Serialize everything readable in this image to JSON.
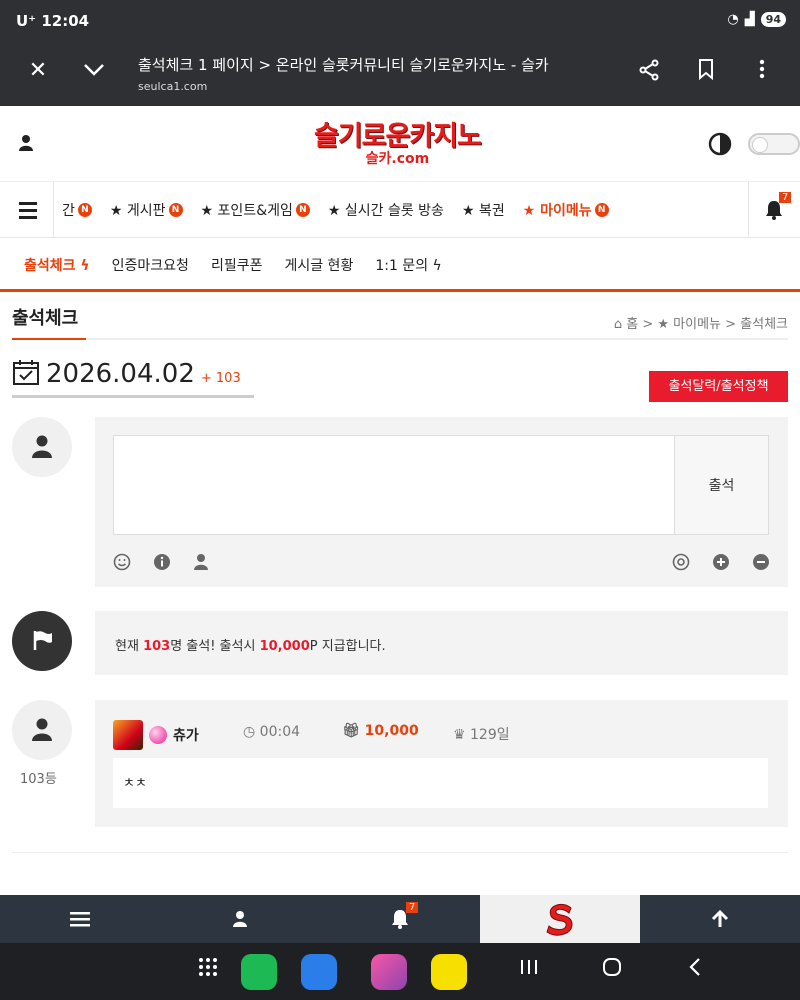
{
  "status": {
    "carrier": "U⁺",
    "time": "12:04",
    "battery": "94"
  },
  "browser": {
    "title": "출석체크 1 페이지 > 온라인 슬롯커뮤니티 슬기로운카지노 - 슬카",
    "url": "seulca1.com"
  },
  "site": {
    "logo_main": "슬기로운카지노",
    "logo_sub": "슬카.com"
  },
  "mainnav": {
    "items": [
      {
        "label": "간",
        "badge": "N"
      },
      {
        "label": "★ 게시판",
        "badge": "N"
      },
      {
        "label": "★ 포인트&게임",
        "badge": "N"
      },
      {
        "label": "★ 실시간 슬롯 방송",
        "badge": ""
      },
      {
        "label": "★ 복권",
        "badge": ""
      },
      {
        "label": "★ 마이메뉴",
        "badge": "N"
      }
    ],
    "notification_count": "7"
  },
  "subnav": {
    "items": [
      "출석체크",
      "인증마크요청",
      "리필쿠폰",
      "게시글 현황",
      "1:1 문의"
    ]
  },
  "page": {
    "title": "출석체크",
    "breadcrumb": "홈 > ★ 마이메뉴 > 출석체크",
    "date": "2026.04.02",
    "date_count": "+ 103",
    "policy_button": "출석달력/출석정책"
  },
  "checkin": {
    "textarea_value": "",
    "submit_label": "출석"
  },
  "notice": {
    "prefix": "현재 ",
    "count": "103",
    "middle": "명 출석! 출석시 ",
    "points": "10,000",
    "suffix": "P 지급합니다."
  },
  "entry": {
    "nickname": "츄가",
    "time": "00:04",
    "points": "10,000",
    "days": "129일",
    "comment": "ㅊㅊ",
    "rank": "103등"
  },
  "bottombar": {
    "notification_count": "7"
  },
  "colors": {
    "accent": "#e8410e",
    "logo_red": "#e31c1c",
    "dark_bar": "#2f3033",
    "bottom_bar": "#2c3540"
  }
}
